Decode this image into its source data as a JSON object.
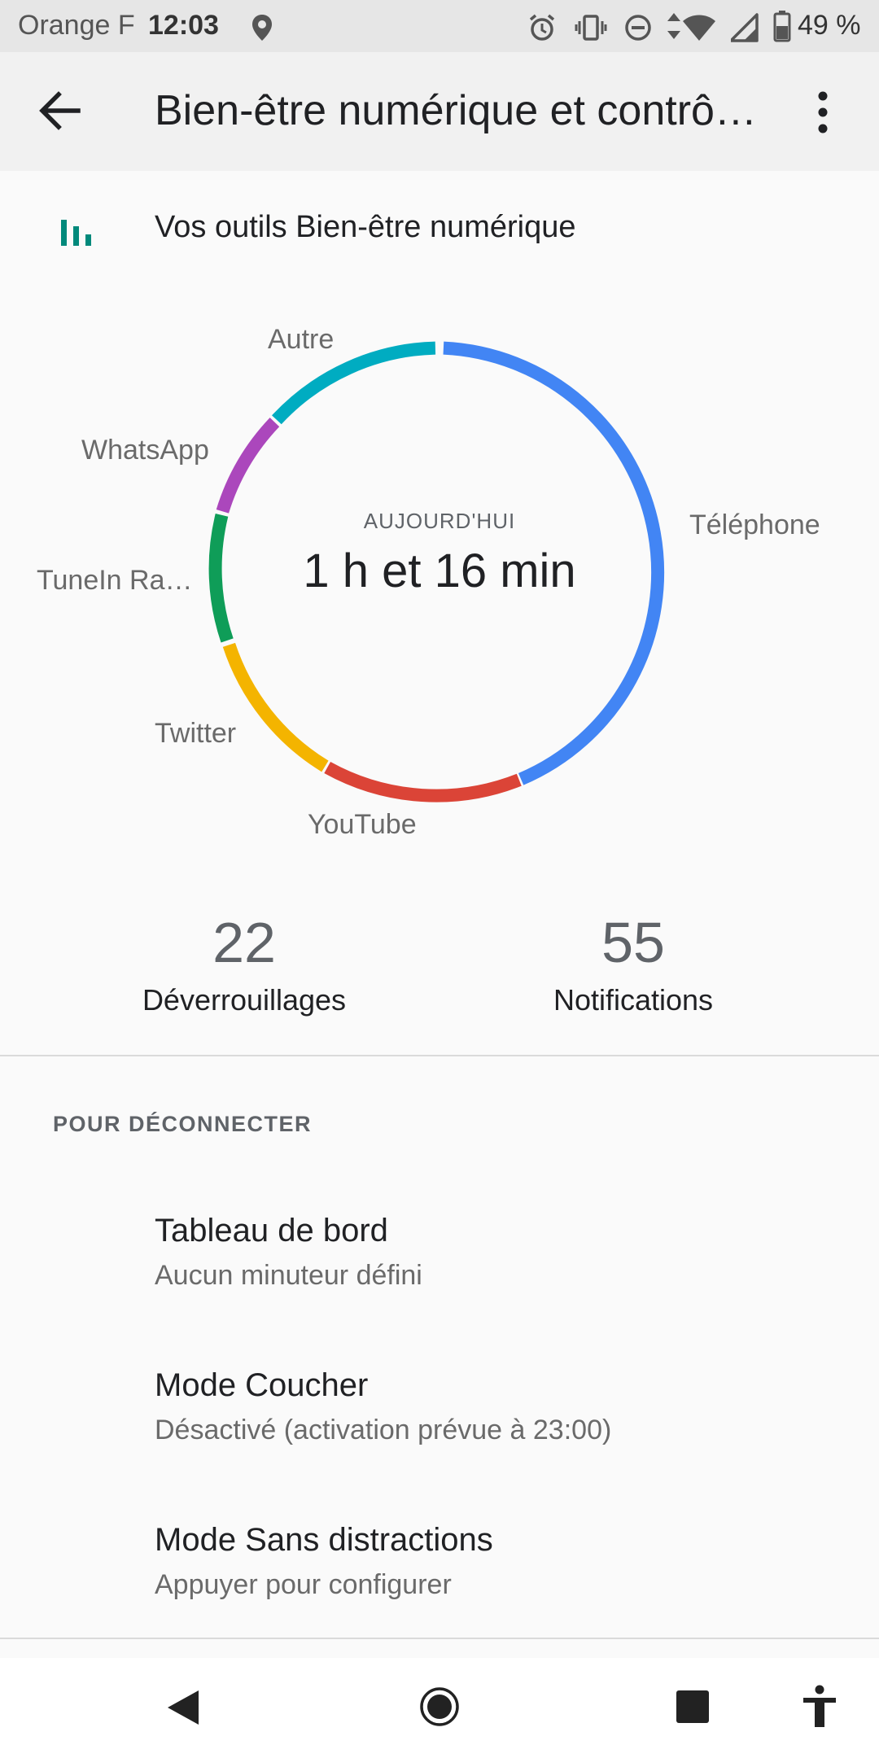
{
  "status_bar": {
    "carrier": "Orange F",
    "time": "12:03",
    "battery": "49 %",
    "icons": [
      "location-icon",
      "alarm-icon",
      "vibrate-icon",
      "dnd-icon",
      "data-icon",
      "wifi-icon",
      "signal-icon",
      "battery-icon"
    ]
  },
  "app_bar": {
    "title": "Bien-être numérique et contrô…",
    "back_icon": "back-arrow-icon",
    "menu_icon": "more-vert-icon"
  },
  "tools": {
    "title": "Vos outils Bien-être numérique",
    "icon": "bar-chart-icon",
    "accent": "#00897b"
  },
  "donut": {
    "center_caption": "AUJOURD'HUI",
    "center_value": "1 h et 16 min",
    "segments": [
      {
        "label": "Téléphone",
        "color": "#4285f4"
      },
      {
        "label": "YouTube",
        "color": "#db4437"
      },
      {
        "label": "Twitter",
        "color": "#f4b400"
      },
      {
        "label": "TuneIn Ra…",
        "color": "#0f9d58"
      },
      {
        "label": "WhatsApp",
        "color": "#ab47bc"
      },
      {
        "label": "Autre",
        "color": "#00acc1"
      }
    ]
  },
  "stats": {
    "unlocks_value": "22",
    "unlocks_label": "Déverrouillages",
    "notifications_value": "55",
    "notifications_label": "Notifications"
  },
  "section": {
    "header": "POUR DÉCONNECTER",
    "items": [
      {
        "title": "Tableau de bord",
        "subtitle": "Aucun minuteur défini"
      },
      {
        "title": "Mode Coucher",
        "subtitle": "Désactivé (activation prévue à 23:00)"
      },
      {
        "title": "Mode Sans distractions",
        "subtitle": "Appuyer pour configurer"
      }
    ]
  },
  "nav_bar": {
    "icons": [
      "nav-back-icon",
      "nav-home-icon",
      "nav-recents-icon",
      "accessibility-icon"
    ]
  }
}
